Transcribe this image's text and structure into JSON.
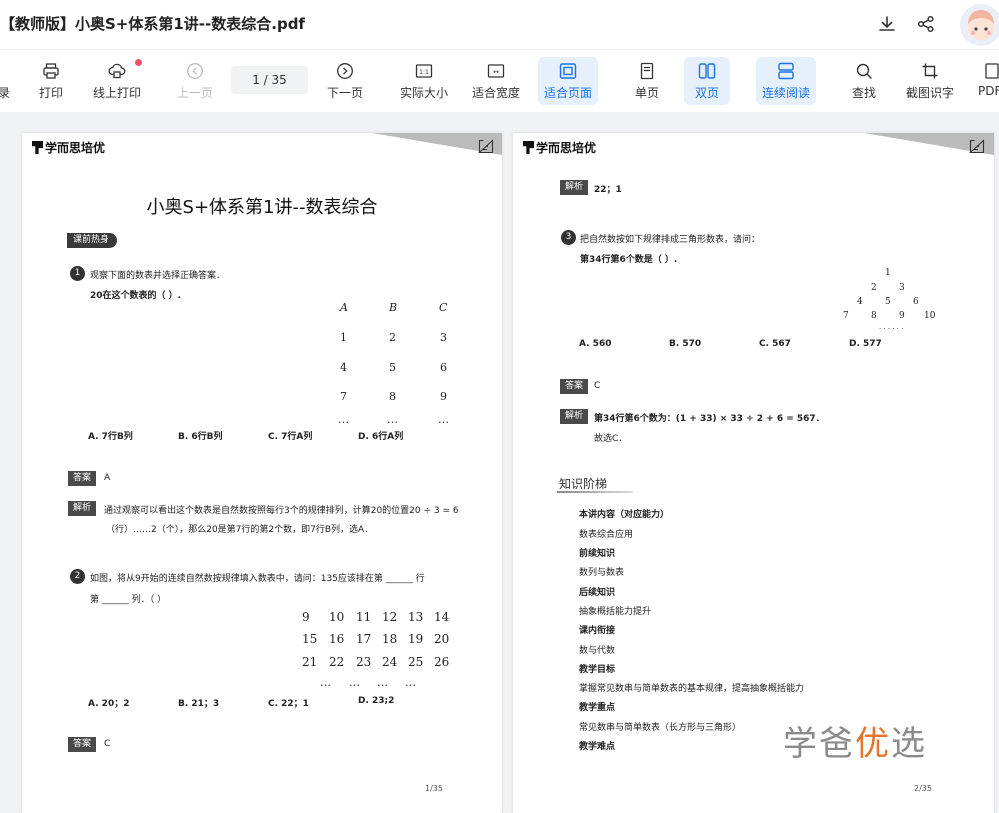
{
  "window": {
    "title": "【教师版】小奥S+体系第1讲--数表综合.pdf"
  },
  "toolbar": {
    "partial_left": "录",
    "print": "打印",
    "online_print": "线上打印",
    "prev_page": "上一页",
    "page_indicator": "1  /  35",
    "next_page": "下一页",
    "actual_size": "实际大小",
    "fit_width": "适合宽度",
    "fit_page": "适合页面",
    "single_page": "单页",
    "double_page": "双页",
    "continuous": "连续阅读",
    "find": "查找",
    "screenshot_ocr": "截图识字",
    "partial_right": "PDF",
    "actual_size_icon_text": "1:1",
    "fit_width_icon_text": "↔"
  },
  "page1": {
    "brand": "学而思培优",
    "title": "小奥S+体系第1讲--数表综合",
    "section": "课前热身",
    "q1": {
      "num": "1",
      "line1": "观察下面的数表并选择正确答案．",
      "line2": "20在这个数表的（   ）.",
      "headers": [
        "A",
        "B",
        "C"
      ],
      "rows": [
        [
          "1",
          "2",
          "3"
        ],
        [
          "4",
          "5",
          "6"
        ],
        [
          "7",
          "8",
          "9"
        ],
        [
          "…",
          "…",
          "…"
        ]
      ],
      "options": [
        "A. 7行B列",
        "B. 6行B列",
        "C. 7行A列",
        "D. 6行A列"
      ],
      "answer_label": "答案",
      "answer": "A",
      "analysis_label": "解析",
      "analysis1": "通过观察可以看出这个数表是自然数按照每行3个的规律排列，计算20的位置20 ÷ 3 = 6",
      "analysis2": "（行）……2（个），那么20是第7行的第2个数，即7行B列，选A．"
    },
    "q2": {
      "num": "2",
      "line1": "如图，将从9开始的连续自然数按规律填入数表中，请问：135应该排在第 ______ 行",
      "line2": "第 ______ 列．（   ）",
      "rows": [
        [
          "9",
          "10",
          "11",
          "12",
          "13",
          "14"
        ],
        [
          "15",
          "16",
          "17",
          "18",
          "19",
          "20"
        ],
        [
          "21",
          "22",
          "23",
          "24",
          "25",
          "26"
        ],
        [
          "…",
          "…",
          "…",
          "…"
        ]
      ],
      "options": [
        "A. 20；2",
        "B. 21；3",
        "C. 22；1",
        "D. 23;2"
      ],
      "answer_label": "答案",
      "answer": "C"
    },
    "page_number": "1/35"
  },
  "page2": {
    "brand": "学而思培优",
    "top_analysis_label": "解析",
    "top_analysis": "22；1",
    "q3": {
      "num": "3",
      "line1": "把自然数按如下规律排成三角形数表，请问：",
      "line2": "第34行第6个数是（   ）.",
      "triangle": [
        [
          "1"
        ],
        [
          "2",
          "3"
        ],
        [
          "4",
          "5",
          "6"
        ],
        [
          "7",
          "8",
          "9",
          "10"
        ],
        [
          ". . . . . ."
        ]
      ],
      "options": [
        "A. 560",
        "B. 570",
        "C. 567",
        "D. 577"
      ],
      "answer_label": "答案",
      "answer": "C",
      "analysis_label": "解析",
      "analysis1": "第34行第6个数为：(1 + 33) × 33 ÷ 2 + 6 = 567．",
      "analysis2": "故选C．"
    },
    "knowledge": {
      "heading": "知识阶梯",
      "lines": [
        {
          "text": "本讲内容（对应能力）",
          "bold": true
        },
        {
          "text": "数表综合应用",
          "bold": false
        },
        {
          "text": "前续知识",
          "bold": true
        },
        {
          "text": "数列与数表",
          "bold": false
        },
        {
          "text": "后续知识",
          "bold": true
        },
        {
          "text": "抽象概括能力提升",
          "bold": false
        },
        {
          "text": "课内衔接",
          "bold": true
        },
        {
          "text": "数与代数",
          "bold": false
        },
        {
          "text": "教学目标",
          "bold": true
        },
        {
          "text": "掌握常见数串与简单数表的基本规律，提高抽象概括能力",
          "bold": false
        },
        {
          "text": "教学重点",
          "bold": true
        },
        {
          "text": "常见数串与简单数表（长方形与三角形）",
          "bold": false
        },
        {
          "text": "教学难点",
          "bold": true
        }
      ]
    },
    "page_number": "2/35"
  },
  "watermark": {
    "part1": "学爸",
    "part2": "优",
    "part3": "选"
  }
}
